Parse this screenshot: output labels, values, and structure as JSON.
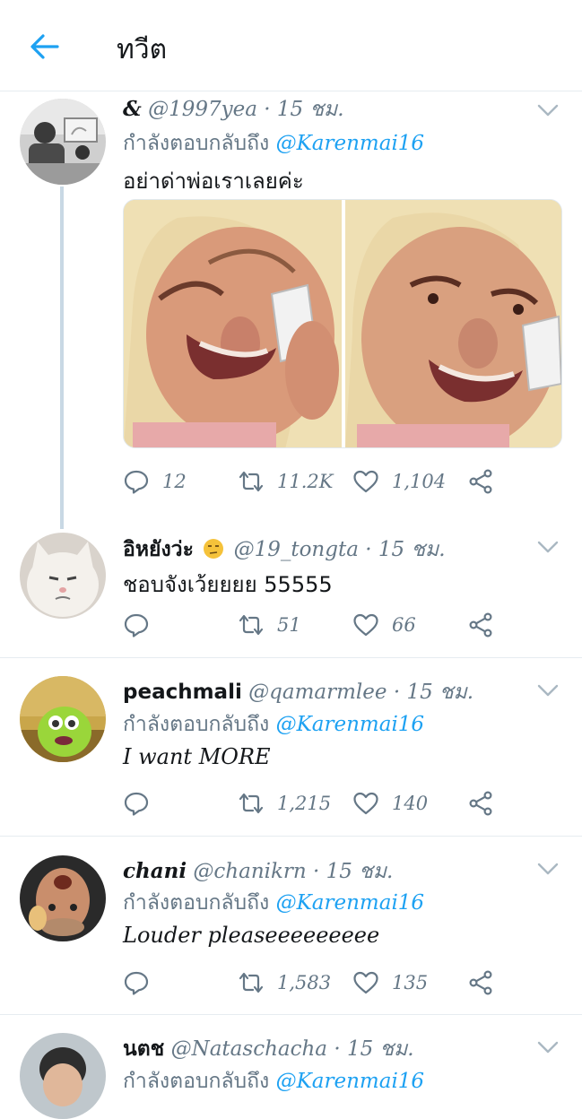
{
  "header": {
    "title": "ทวีต",
    "back_icon": "arrow-left-icon"
  },
  "colors": {
    "accent": "#1da1f2",
    "secondary_text": "#657786",
    "divider": "#e6ecf0"
  },
  "tweets": [
    {
      "display_name": "&",
      "handle": "@1997yea",
      "time": "· 15 ชม.",
      "reply_prefix": "กำลังตอบกลับถึง",
      "reply_to": "@Karenmai16",
      "text": "อย่าด่าพ่อเราเลยค่ะ",
      "replies": "12",
      "retweets": "11.2K",
      "likes": "1,104"
    },
    {
      "display_name": "อิหยังว่ะ",
      "display_emoji": "unamused-face-emoji",
      "handle": "@19_tongta",
      "time": "· 15 ชม.",
      "text": "ชอบจังเว้ยยยย 55555",
      "replies": "",
      "retweets": "51",
      "likes": "66"
    },
    {
      "display_name": "peachmali",
      "handle": "@qamarmlee",
      "time": "· 15 ชม.",
      "reply_prefix": "กำลังตอบกลับถึง",
      "reply_to": "@Karenmai16",
      "text": "I want MORE",
      "replies": "",
      "retweets": "1,215",
      "likes": "140"
    },
    {
      "display_name": "chani",
      "handle": "@chanikrn",
      "time": "· 15 ชม.",
      "reply_prefix": "กำลังตอบกลับถึง",
      "reply_to": "@Karenmai16",
      "text": "Louder pleaseeeeeeeee",
      "replies": "",
      "retweets": "1,583",
      "likes": "135"
    },
    {
      "display_name": "นตช",
      "handle": "@Nataschacha",
      "time": "· 15 ชม.",
      "reply_prefix": "กำลังตอบกลับถึง",
      "reply_to": "@Karenmai16"
    }
  ]
}
